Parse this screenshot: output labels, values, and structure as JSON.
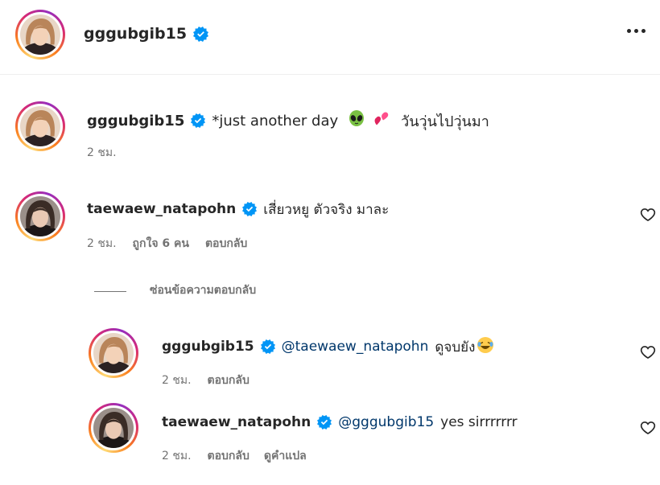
{
  "header": {
    "username": "gggubgib15"
  },
  "caption": {
    "username": "gggubgib15",
    "text": "*just another day",
    "text_after_emoji": "วันวุ่นไปวุ่นมา",
    "time": "2 ชม."
  },
  "comment1": {
    "username": "taewaew_natapohn",
    "text": "เสี่ยวหยู ตัวจริง มาละ",
    "time": "2 ชม.",
    "likes": "ถูกใจ 6 คน",
    "reply_label": "ตอบกลับ"
  },
  "hide_replies": {
    "label": "ซ่อนข้อความตอบกลับ"
  },
  "reply1": {
    "username": "gggubgib15",
    "mention": "@taewaew_natapohn",
    "text": "ดูจบยัง",
    "time": "2 ชม.",
    "reply_label": "ตอบกลับ"
  },
  "reply2": {
    "username": "taewaew_natapohn",
    "mention": "@gggubgib15",
    "text": "yes sirrrrrrr",
    "time": "2 ชม.",
    "reply_label": "ตอบกลับ",
    "translate_label": "ดูคำแปล"
  },
  "icons": {
    "verified": "verified-badge-icon",
    "heart": "heart-outline-icon",
    "more": "more-options-icon",
    "alien": "alien-emoji",
    "hearts": "two-hearts-emoji",
    "laugh": "laughing-emoji"
  },
  "colors": {
    "verified": "#0095f6",
    "mention": "#00376b",
    "meta": "#737373"
  }
}
